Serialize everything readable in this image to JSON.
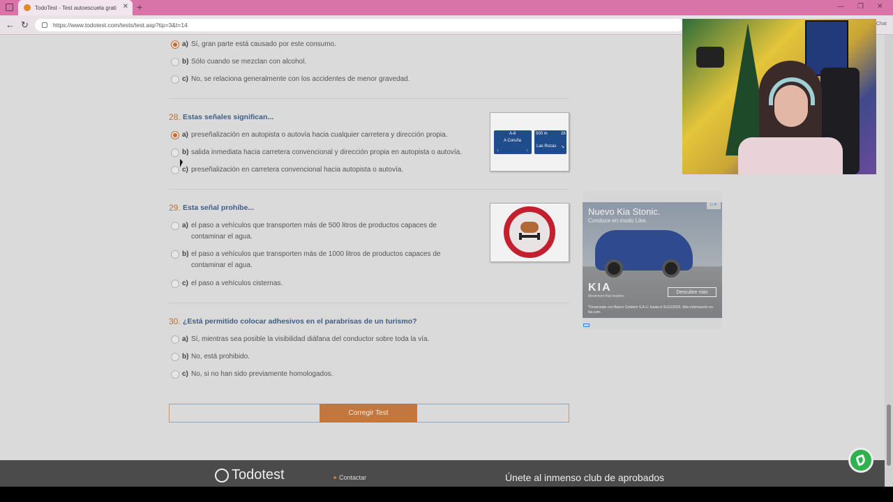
{
  "browser": {
    "tab_title": "TodoTest - Test autoescuela grati",
    "tab_close": "✕",
    "new_tab": "+",
    "url": "https://www.todotest.com/tests/test.asp?tip=3&t=14",
    "side_label": "Chat",
    "win_min": "—",
    "win_max": "❐",
    "win_close": "✕"
  },
  "q27": {
    "options": [
      {
        "letter": "a)",
        "text": "Sí, gran parte está causado por este consumo.",
        "selected": true
      },
      {
        "letter": "b)",
        "text": "Sólo cuando se mezclan con alcohol.",
        "selected": false
      },
      {
        "letter": "c)",
        "text": "No, se relaciona generalmente con los accidentes de menor gravedad.",
        "selected": false
      }
    ]
  },
  "q28": {
    "number": "28.",
    "question": "Estas señales significan...",
    "options": [
      {
        "letter": "a)",
        "text": "preseñalización en autopista o autovía hacia cualquier carretera y dirección propia.",
        "selected": true
      },
      {
        "letter": "b)",
        "text": "salida inmediata hacia carretera convencional y dirección propia en autopista o autovía.",
        "selected": false
      },
      {
        "letter": "c)",
        "text": "preseñalización en carretera convencional hacia autopista o autovía.",
        "selected": false
      }
    ],
    "sign_left_top": "A-6",
    "sign_left_city": "A Coruña",
    "sign_right_top": "500 m",
    "sign_right_num": "26",
    "sign_right_city": "Las Rozas"
  },
  "q29": {
    "number": "29.",
    "question": "Esta señal prohíbe...",
    "options": [
      {
        "letter": "a)",
        "text": "el paso a vehículos que transporten más de 500 litros de productos capaces de contaminar el agua.",
        "selected": false
      },
      {
        "letter": "b)",
        "text": "el paso a vehículos que transporten más de 1000 litros de productos capaces de contaminar el agua.",
        "selected": false
      },
      {
        "letter": "c)",
        "text": "el paso a vehículos cisternas.",
        "selected": false
      }
    ]
  },
  "q30": {
    "number": "30.",
    "question": "¿Está permitido colocar adhesivos en el parabrisas de un turismo?",
    "options": [
      {
        "letter": "a)",
        "text": "Sí, mientras sea posible la visibilidad diáfana del conductor sobre toda la vía.",
        "selected": false
      },
      {
        "letter": "b)",
        "text": "No, está prohibido.",
        "selected": false
      },
      {
        "letter": "c)",
        "text": "No, si no han sido previamente homologados.",
        "selected": false
      }
    ]
  },
  "actions": {
    "correct_button": "Corregir Test"
  },
  "ad": {
    "title": "Nuevo Kia Stonic.",
    "subtitle": "Conduce en modo Like.",
    "brand": "KIA",
    "tagline": "Movement that inspires",
    "cta": "Descubre más",
    "legal": "*Financiado con Banco Cetelem S.A.U. hasta el 31/12/2025. Más información en kia.com.",
    "badge": "▷✕"
  },
  "footer": {
    "logo": "Todotest",
    "contact": "Contactar",
    "slogan": "Únete al inmenso club de aprobados"
  },
  "colors": {
    "accent": "#c3773d",
    "question_text": "#3f5e86",
    "tab_bar": "#d874a7",
    "footer_bg": "#4b4b4b"
  }
}
